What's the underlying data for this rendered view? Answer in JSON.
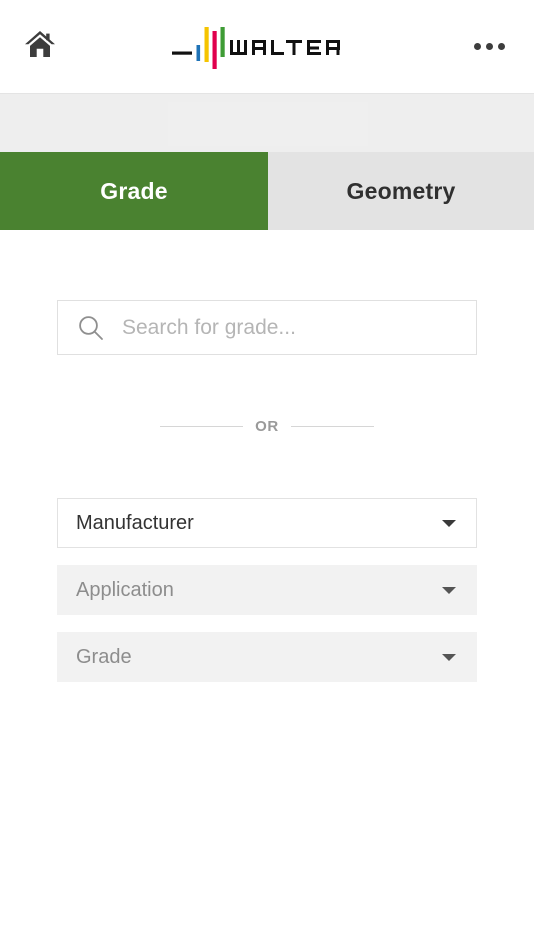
{
  "header": {
    "home_icon": "home-icon",
    "more_icon": "more-options-icon",
    "brand": {
      "name": "WALTER",
      "bar_colors": [
        "#1f73b7",
        "#f5c400",
        "#e0004d",
        "#3f9c35"
      ],
      "dash_color": "#111111"
    }
  },
  "tabs": [
    {
      "label": "Grade",
      "active": true
    },
    {
      "label": "Geometry",
      "active": false
    }
  ],
  "search": {
    "icon": "search-icon",
    "placeholder": "Search for grade...",
    "value": ""
  },
  "divider": {
    "text": "OR"
  },
  "selects": [
    {
      "label": "Manufacturer",
      "state": "enabled",
      "caret": "chevron-down-icon"
    },
    {
      "label": "Application",
      "state": "disabled",
      "caret": "chevron-down-icon"
    },
    {
      "label": "Grade",
      "state": "disabled",
      "caret": "chevron-down-icon"
    }
  ],
  "colors": {
    "accent_green": "#4a8230",
    "tab_inactive_bg": "#e3e3e3",
    "band_bg": "#eeeeee",
    "field_disabled_bg": "#f2f2f2",
    "placeholder": "#b5b5b5"
  }
}
